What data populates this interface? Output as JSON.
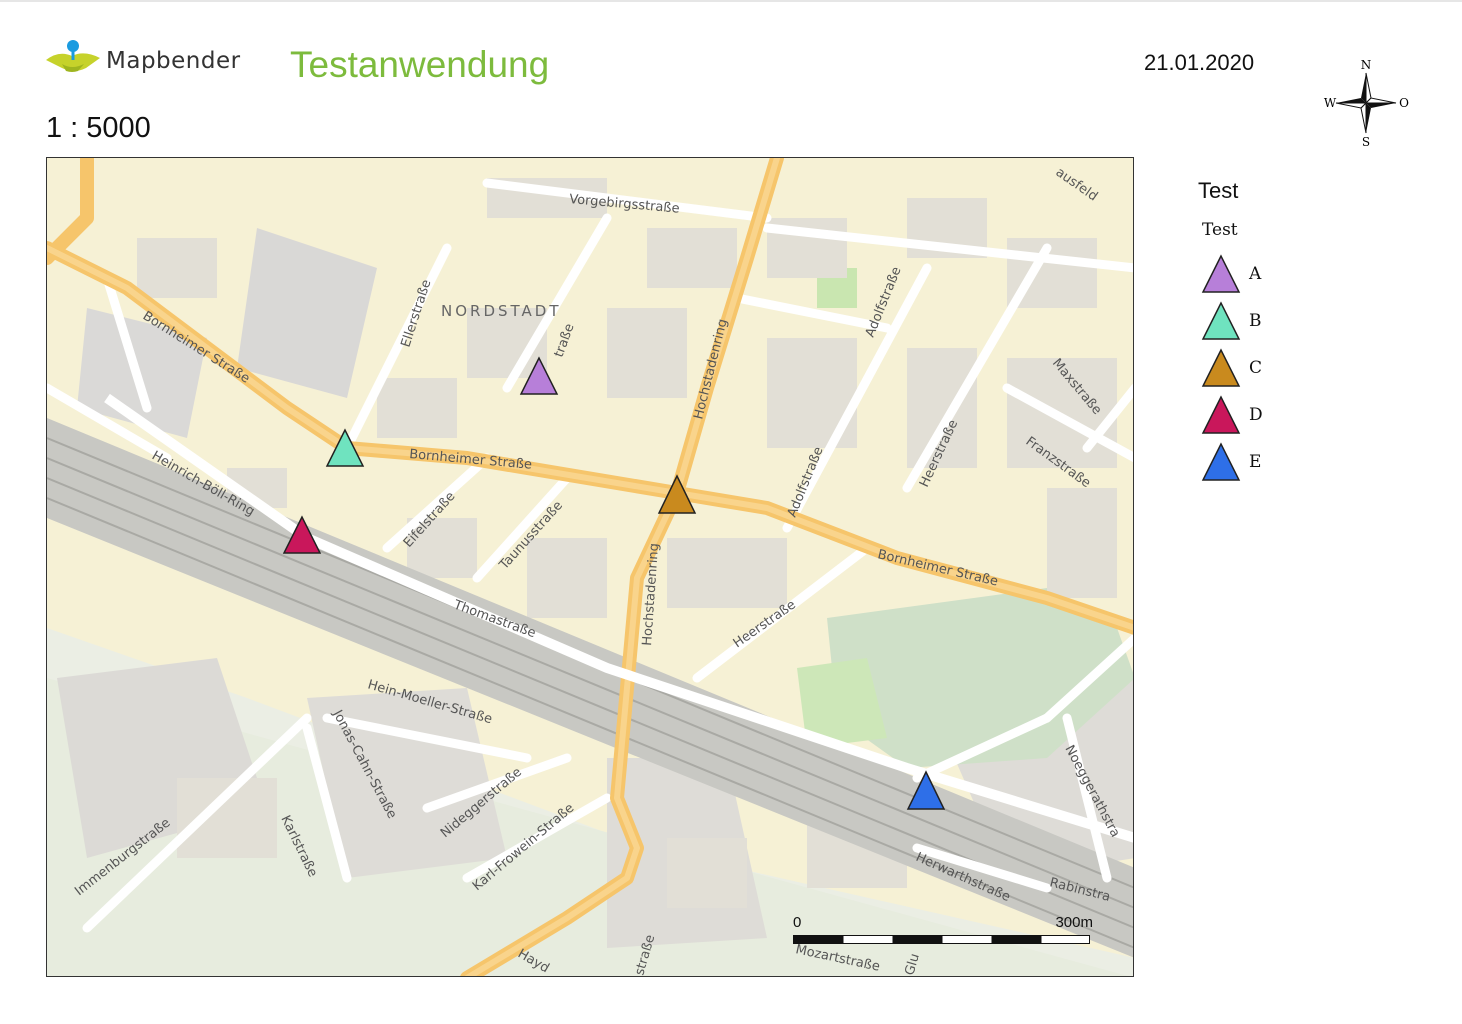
{
  "header": {
    "logo_text": "Mapbender",
    "title": "Testanwendung",
    "date": "21.01.2020",
    "scale": "1 : 5000"
  },
  "compass": {
    "north": "N",
    "south": "S",
    "west": "W",
    "east": "O"
  },
  "legend": {
    "title": "Test",
    "subtitle": "Test",
    "items": [
      {
        "label": "A",
        "color": "#b77fd9"
      },
      {
        "label": "B",
        "color": "#6fe3bf"
      },
      {
        "label": "C",
        "color": "#c98a1e"
      },
      {
        "label": "D",
        "color": "#c9175b"
      },
      {
        "label": "E",
        "color": "#2e6fe8"
      }
    ]
  },
  "map": {
    "district": "NORDSTADT",
    "streets": [
      "Vorgebirgsstraße",
      "Bornheimer Straße",
      "Bornheimer Straße",
      "Bornheimer Straße",
      "Hochstadenring",
      "Hochstadenring",
      "Ellerstraße",
      "Adolfstraße",
      "Adolfstraße",
      "Heerstraße",
      "Heerstraße",
      "Maxstraße",
      "Franzstraße",
      "Heinrich-Böll-Ring",
      "Eifelstraße",
      "Taunusstraße",
      "Thomastraße",
      "Hein-Moeller-Straße",
      "Jonas-Cahn-Straße",
      "Nideggerstraße",
      "Karl-Frowein-Straße",
      "Immenburgstraße",
      "Karlstraße",
      "Herwarthstraße",
      "Rabinstra",
      "Noeggerathstra",
      "Mozartstraße",
      "Glu",
      "Hayd",
      "straße",
      "ausfeld",
      "traße"
    ],
    "scalebar": {
      "start": "0",
      "end": "300m"
    }
  }
}
